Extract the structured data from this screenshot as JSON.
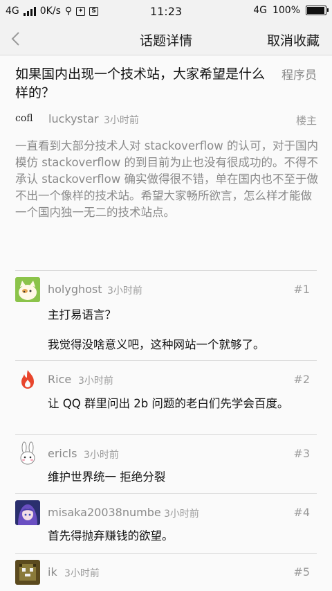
{
  "status_bar": {
    "network": "4G",
    "speed": "0K/s",
    "time": "11:23",
    "network_right": "4G",
    "battery": "100%"
  },
  "nav": {
    "title": "话题详情",
    "action": "取消收藏"
  },
  "question": {
    "title": "如果国内出现一个技术站，大家希望是什么样的？",
    "tag": "程序员"
  },
  "op": {
    "avatar_text": "cofl",
    "name": "luckystar",
    "time": "3小时前",
    "badge": "楼主",
    "body": "一直看到大部分技术人对 stackoverflow 的认可，对于国内模仿 stackoverflow 的到目前为止也没有很成功的。不得不承认 stackoverflow 确实做得很不错，单在国内也不至于做不出一个像样的技术站。希望大家畅所欲言，怎么样才能做一个国内独一无二的技术站点。"
  },
  "replies": [
    {
      "name": "holyghost",
      "time": "3小时前",
      "floor": "#1",
      "line1": "主打易语言？",
      "line2": "我觉得没啥意义吧，这种网站一个就够了。",
      "avatar": "cat"
    },
    {
      "name": "Rice",
      "time": "3小时前",
      "floor": "#2",
      "line1": "让 QQ 群里问出 2b 问题的老白们先学会百度。",
      "line2": "",
      "avatar": "flame"
    },
    {
      "name": "ericls",
      "time": "3小时前",
      "floor": "#3",
      "line1": "维护世界统一 拒绝分裂",
      "line2": "",
      "avatar": "rabbit"
    },
    {
      "name": "misaka20038numbe",
      "time": "3小时前",
      "floor": "#4",
      "line1": "首先得抛弃赚钱的欲望。",
      "line2": "",
      "avatar": "anime"
    },
    {
      "name": "ik",
      "time": "3小时前",
      "floor": "#5",
      "line1": "",
      "line2": "",
      "avatar": "pixel"
    }
  ],
  "colors": {
    "background": "#fafafa",
    "bar": "#f2f2f2",
    "muted_text": "#8a8a8a",
    "divider": "#d8d8d8"
  }
}
